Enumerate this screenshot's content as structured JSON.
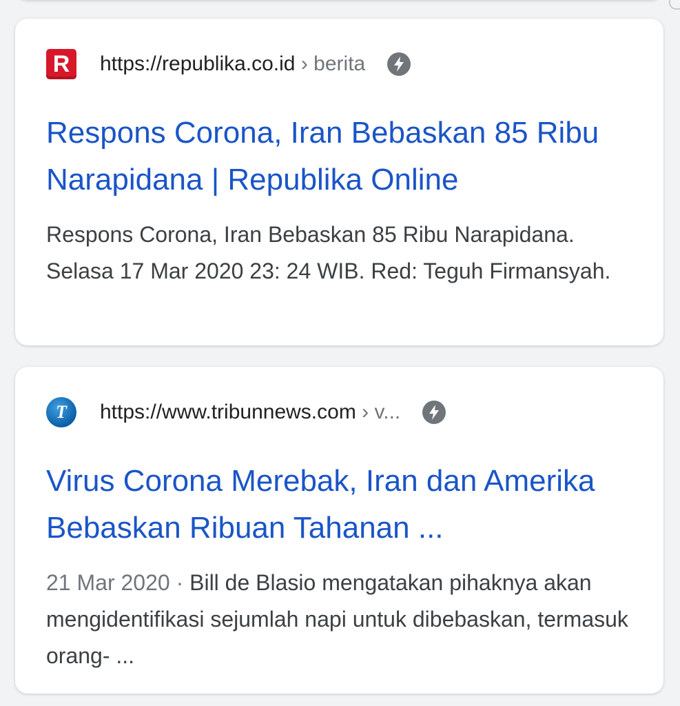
{
  "results": [
    {
      "favicon": {
        "name": "republika-logo",
        "glyph": "R",
        "color": "#d7182a"
      },
      "url": "https://republika.co.id",
      "breadcrumb": "› berita",
      "amp_icon": "lightning-icon",
      "title": "Respons Corona, Iran Bebaskan 85 Ribu Narapidana | Republika Online",
      "date": "",
      "snippet": "Respons Corona, Iran Bebaskan 85 Ribu Narapidana. Selasa 17 Mar 2020 23: 24 WIB. Red: Teguh Firmansyah."
    },
    {
      "favicon": {
        "name": "tribunnews-logo",
        "glyph": "T",
        "color": "#0b5ea8"
      },
      "url": "https://www.tribunnews.com",
      "breadcrumb": "› v...",
      "amp_icon": "lightning-icon",
      "title": "Virus Corona Merebak, Iran dan Amerika Bebaskan Ribuan Tahanan ...",
      "date": "21 Mar 2020 · ",
      "snippet": "Bill de Blasio mengatakan pihaknya akan mengidentifikasi sejumlah napi untuk dibebaskan, termasuk orang- ..."
    }
  ],
  "colors": {
    "link": "#1a55c7",
    "text": "#3c4043",
    "meta": "#70757a",
    "background": "#f1f3f4"
  }
}
